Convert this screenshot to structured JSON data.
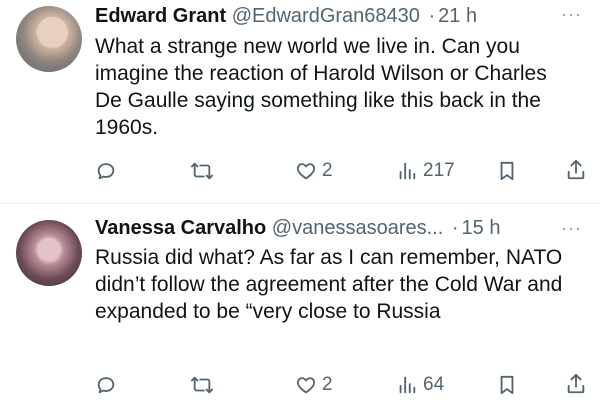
{
  "tweets": [
    {
      "name": "Edward Grant",
      "handle": "@EdwardGran68430",
      "separator": "·",
      "time": "21 h",
      "text": "What a strange new world we live in. Can you imagine the reaction of Harold Wilson or Charles De Gaulle saying something like this back in the 1960s.",
      "likes": "2",
      "views": "217",
      "more": "···"
    },
    {
      "name": "Vanessa Carvalho",
      "handle": "@vanessasoares...",
      "separator": "·",
      "time": "15 h",
      "text": "Russia did what? As far as I can remember, NATO didn’t follow the agreement after the Cold War and expanded to be “very close to Russia",
      "likes": "2",
      "views": "64",
      "more": "···"
    }
  ],
  "icons": {
    "reply": "reply-icon",
    "retweet": "retweet-icon",
    "like": "heart-icon",
    "views": "views-icon",
    "bookmark": "bookmark-icon",
    "share": "share-icon"
  },
  "colors": {
    "text": "#0f1419",
    "secondary": "#536471",
    "divider": "#eff3f4"
  }
}
